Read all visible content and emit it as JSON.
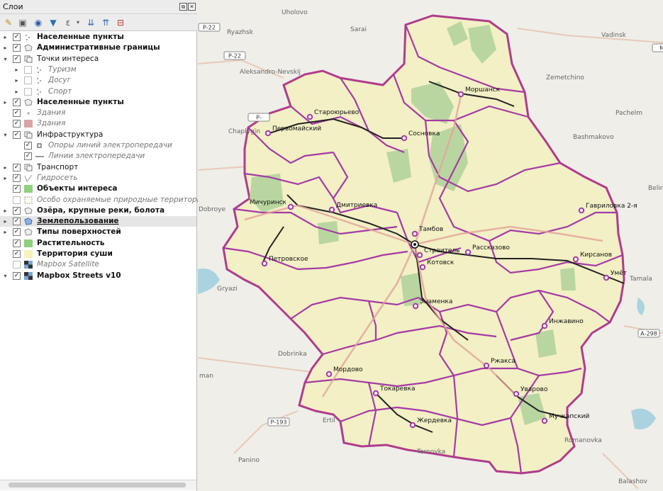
{
  "panel": {
    "title": "Слои",
    "float_btn": "⧉",
    "close_btn": "✕"
  },
  "toolbar": {
    "icons": [
      "open-layer-styling-icon",
      "add-group-icon",
      "manage-visibility-icon",
      "filter-legend-icon",
      "filter-expression-icon",
      "expand-all-icon",
      "collapse-all-icon",
      "remove-layer-icon"
    ]
  },
  "layers": [
    {
      "label": "Населенные пункты",
      "style": "b",
      "checked": true,
      "arrow": "▸",
      "icon": "dots",
      "indent": 0
    },
    {
      "label": "Административные границы",
      "style": "b",
      "checked": true,
      "arrow": "▸",
      "icon": "poly",
      "indent": 0
    },
    {
      "label": "Точки интереса",
      "style": "n",
      "checked": true,
      "arrow": "▾",
      "icon": "group",
      "indent": 0
    },
    {
      "label": "Туризм",
      "style": "i",
      "checked": false,
      "arrow": "▸",
      "icon": "dots",
      "indent": 1
    },
    {
      "label": "Досуг",
      "style": "i",
      "checked": false,
      "arrow": "▸",
      "icon": "dots",
      "indent": 1
    },
    {
      "label": "Спорт",
      "style": "i",
      "checked": false,
      "arrow": "▸",
      "icon": "dots",
      "indent": 1
    },
    {
      "label": "Населенные пункты",
      "style": "b",
      "checked": true,
      "arrow": "▸",
      "icon": "poly",
      "indent": 0
    },
    {
      "label": "Здания",
      "style": "i",
      "checked": true,
      "arrow": "",
      "icon": "pt",
      "indent": 0
    },
    {
      "label": "Здания",
      "style": "i",
      "checked": true,
      "arrow": "",
      "icon": "pinkfill",
      "indent": 0
    },
    {
      "label": "Инфраструктура",
      "style": "n",
      "checked": true,
      "arrow": "▾",
      "icon": "group",
      "indent": 0
    },
    {
      "label": "Опоры линий электропередачи",
      "style": "i",
      "checked": true,
      "arrow": "",
      "icon": "square",
      "indent": 1
    },
    {
      "label": "Линии электропередачи",
      "style": "i",
      "checked": true,
      "arrow": "",
      "icon": "line",
      "indent": 1
    },
    {
      "label": "Транспорт",
      "style": "n",
      "checked": true,
      "arrow": "▸",
      "icon": "group",
      "indent": 0
    },
    {
      "label": "Гидросеть",
      "style": "i",
      "checked": true,
      "arrow": "▸",
      "icon": "vline",
      "indent": 0
    },
    {
      "label": "Объекты интереса",
      "style": "b",
      "checked": true,
      "arrow": "",
      "icon": "greenfill",
      "indent": 0
    },
    {
      "label": "Особо охраняемые природные территории",
      "style": "i",
      "checked": false,
      "arrow": "",
      "icon": "dashed",
      "indent": 0
    },
    {
      "label": "Озёра, крупные реки, болота",
      "style": "b",
      "checked": true,
      "arrow": "▸",
      "icon": "poly",
      "indent": 0
    },
    {
      "label": "Землепользование",
      "style": "bu",
      "checked": true,
      "arrow": "▸",
      "icon": "bluepoly",
      "indent": 0,
      "selected": true
    },
    {
      "label": "Типы поверхностей",
      "style": "b",
      "checked": true,
      "arrow": "▸",
      "icon": "poly",
      "indent": 0
    },
    {
      "label": "Растительность",
      "style": "b",
      "checked": true,
      "arrow": "",
      "icon": "greenfill",
      "indent": 0
    },
    {
      "label": "Территория суши",
      "style": "b",
      "checked": true,
      "arrow": "",
      "icon": "yellowfill",
      "indent": 0
    },
    {
      "label": "Mapbox Satellite",
      "style": "i",
      "checked": false,
      "arrow": "",
      "icon": "tile",
      "indent": 0
    },
    {
      "label": "Mapbox Streets v10",
      "style": "b",
      "checked": true,
      "arrow": "▾",
      "icon": "tile",
      "indent": 0
    }
  ],
  "map": {
    "colors": {
      "boundary": "#a63aa6",
      "outer_boundary": "#b03c8c",
      "land": "#f2f0c4",
      "forest": "#b9d6a0",
      "basemap": "#efeee9",
      "road": "#e3a29a",
      "rail": "#222222",
      "water": "#aad3df"
    },
    "towns": [
      {
        "name": "Моршанск"
      },
      {
        "name": "Староюрьево"
      },
      {
        "name": "Первомайский"
      },
      {
        "name": "Сосновка"
      },
      {
        "name": "Мичуринск"
      },
      {
        "name": "Дмитриевка"
      },
      {
        "name": "Тамбов"
      },
      {
        "name": "Строитель"
      },
      {
        "name": "Рассказово"
      },
      {
        "name": "Котовск"
      },
      {
        "name": "Гавриловка 2-я"
      },
      {
        "name": "Кирсанов"
      },
      {
        "name": "Умёт"
      },
      {
        "name": "Петровское"
      },
      {
        "name": "Знаменка"
      },
      {
        "name": "Инжавино"
      },
      {
        "name": "Ржакса"
      },
      {
        "name": "Мордово"
      },
      {
        "name": "Токаревка"
      },
      {
        "name": "Уварово"
      },
      {
        "name": "Мучкапский"
      },
      {
        "name": "Жердевка"
      }
    ],
    "external_places": [
      {
        "name": "Uholovo"
      },
      {
        "name": "Ryazhsk"
      },
      {
        "name": "Sarai"
      },
      {
        "name": "Vadinsk"
      },
      {
        "name": "Aleksandro-Nevskij"
      },
      {
        "name": "Zemetchino"
      },
      {
        "name": "Pachelm"
      },
      {
        "name": "Chaplygin"
      },
      {
        "name": "Bashmakovo"
      },
      {
        "name": "Belin"
      },
      {
        "name": "Dobroye"
      },
      {
        "name": "Tamala"
      },
      {
        "name": "Gryazi"
      },
      {
        "name": "Dobrinka"
      },
      {
        "name": "Ertil"
      },
      {
        "name": "Ternovka"
      },
      {
        "name": "Panino"
      },
      {
        "name": "Romanovka"
      },
      {
        "name": "Balashov"
      },
      {
        "name": "man"
      }
    ],
    "road_shields": [
      "Р-22",
      "Р-22",
      "Р-",
      "М-",
      "А-298",
      "Р-193"
    ]
  }
}
